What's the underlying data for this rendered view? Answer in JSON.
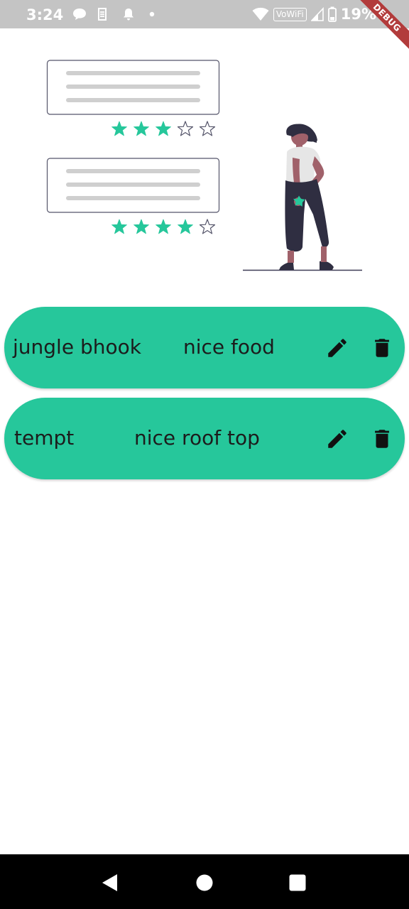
{
  "status_bar": {
    "time": "3:24",
    "network_label": "VoWiFi",
    "battery_percent": "19%",
    "icons": [
      "chat-icon",
      "sim-icon",
      "notification-bell-icon",
      "dot-icon",
      "wifi-icon",
      "signal-icon",
      "battery-icon"
    ]
  },
  "debug_banner": "DEBUG",
  "illustration": {
    "ratings": [
      3,
      4
    ],
    "max_rating": 5,
    "accent_color": "#26c79b"
  },
  "reviews": [
    {
      "name": "jungle bhook",
      "comment": "nice food"
    },
    {
      "name": "tempt",
      "comment": "nice roof top"
    }
  ],
  "nav_bar": {
    "buttons": [
      "back-icon",
      "home-icon",
      "recents-icon"
    ]
  },
  "colors": {
    "card": "#26c79b",
    "status_bar": "#c4c4c4",
    "nav_bar": "#000000"
  }
}
